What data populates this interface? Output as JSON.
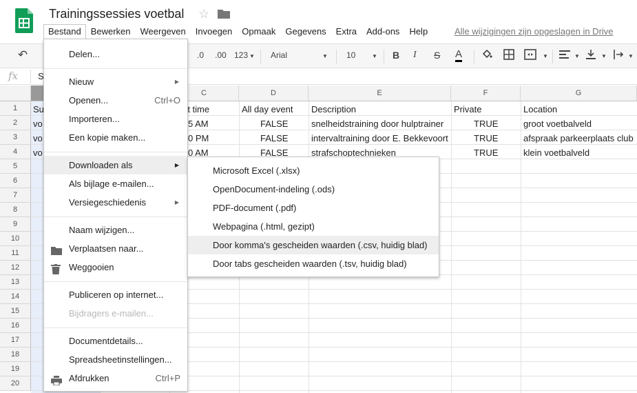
{
  "doc": {
    "title": "Trainingssessies voetbal",
    "saved_status": "Alle wijzigingen zijn opgeslagen in Drive"
  },
  "menubar": [
    "Bestand",
    "Bewerken",
    "Weergeven",
    "Invoegen",
    "Opmaak",
    "Gegevens",
    "Extra",
    "Add-ons",
    "Help"
  ],
  "toolbar": {
    "dec_less": ".0",
    "dec_more": ".00",
    "format": "123",
    "font": "Arial",
    "size": "10"
  },
  "formula_bar": {
    "fx": "fx",
    "value": "S"
  },
  "columns": [
    "",
    "C",
    "D",
    "E",
    "F",
    "G"
  ],
  "rows": [
    "1",
    "2",
    "3",
    "4",
    "5",
    "6",
    "7",
    "8",
    "9",
    "10",
    "11",
    "12",
    "13",
    "14",
    "15",
    "16",
    "17",
    "18",
    "19",
    "20"
  ],
  "cells": {
    "r1": [
      "Su",
      "rt time",
      "All day event",
      "Description",
      "Private",
      "Location"
    ],
    "r2": [
      "vo",
      "5 AM",
      "FALSE",
      "snelheidstraining door hulptrainer",
      "TRUE",
      "groot voetbalveld"
    ],
    "r3": [
      "vo",
      "0 PM",
      "FALSE",
      "intervaltraining door E. Bekkevoort",
      "TRUE",
      "afspraak parkeerplaats club"
    ],
    "r4": [
      "vo",
      "0 AM",
      "FALSE",
      "strafschoptechnieken",
      "TRUE",
      "klein voetbalveld"
    ]
  },
  "file_menu": {
    "share": "Delen...",
    "new": "Nieuw",
    "open": "Openen...",
    "open_sc": "Ctrl+O",
    "import": "Importeren...",
    "copy": "Een kopie maken...",
    "download": "Downloaden als",
    "email": "Als bijlage e-mailen...",
    "history": "Versiegeschiedenis",
    "rename": "Naam wijzigen...",
    "move": "Verplaatsen naar...",
    "trash": "Weggooien",
    "publish": "Publiceren op internet...",
    "email_collab": "Bijdragers e-mailen...",
    "details": "Documentdetails...",
    "settings": "Spreadsheetinstellingen...",
    "print": "Afdrukken",
    "print_sc": "Ctrl+P"
  },
  "download_submenu": [
    "Microsoft Excel (.xlsx)",
    "OpenDocument-indeling (.ods)",
    "PDF-document (.pdf)",
    "Webpagina (.html, gezipt)",
    "Door komma's gescheiden waarden (.csv, huidig blad)",
    "Door tabs gescheiden waarden (.tsv, huidig blad)"
  ],
  "colors": {
    "sheets_green": "#0f9d58",
    "highlight": "#eeeeee",
    "selected_col": "#e8eefa"
  }
}
